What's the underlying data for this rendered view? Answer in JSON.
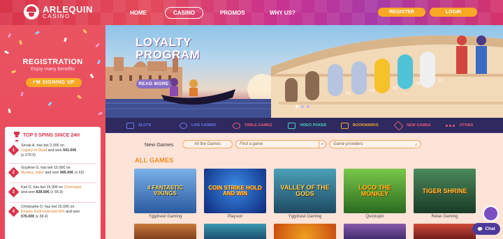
{
  "header": {
    "logo_line1": "ARLEQUIN",
    "logo_line2": "CASINO",
    "nav": [
      {
        "label": "HOME"
      },
      {
        "label": "CASINO"
      },
      {
        "label": "PROMOS"
      },
      {
        "label": "WHY US?"
      }
    ],
    "register_label": "REGISTER",
    "login_label": "LOGIN",
    "accent": "#f9a825"
  },
  "sidebar": {
    "reg_title": "REGISTRATION",
    "reg_sub": "Enjoy many benefits",
    "signup_label": "I'M SIGNING UP",
    "spins_title": "TOP 5 SPINS SINCE 24H",
    "spins": [
      {
        "num": "1",
        "who": "Sevak A. has bet 2.00€ on",
        "game": "Legacy of Dead",
        "rest": "and won",
        "win": "541.00€",
        "mult": "(x 270.5)"
      },
      {
        "num": "2",
        "who": "Guylene G. has bet 15.00€ on",
        "game": "Mystery Joker",
        "rest": "and won",
        "win": "945.00€",
        "mult": "(x 63)"
      },
      {
        "num": "3",
        "who": "Karl D. has bet 15.00€ on",
        "game": "Cherrypop",
        "rest": "and won",
        "win": "838.60€",
        "mult": "(x 55.9)"
      },
      {
        "num": "4",
        "who": "Christophe D. has bet 15.00€ on",
        "game": "Empire Gold Hold and Win",
        "rest": "and won",
        "win": "576.00€",
        "mult": "(x 38.4)"
      }
    ]
  },
  "hero": {
    "title_line1": "LOYALTY",
    "title_line2": "PROGRAM",
    "read_more": "READ MORE",
    "arch_numbers": [
      "03",
      "04",
      "05",
      "06",
      "07"
    ]
  },
  "categories": [
    {
      "label": "SLOTS",
      "color": "#6a7cf0"
    },
    {
      "label": "LIVE CASINO",
      "color": "#6a7cf0"
    },
    {
      "label": "TABLE GAMES",
      "color": "#e85a7a"
    },
    {
      "label": "VIDEO POKER",
      "color": "#4fd1c5"
    },
    {
      "label": "BOOKMARKS",
      "color": "#f0a830"
    },
    {
      "label": "NEW GAMES",
      "color": "#e85a7a"
    },
    {
      "label": "OTHER",
      "color": "#e85a7a"
    }
  ],
  "filters": {
    "label": "New Games",
    "all_games": "All the Games",
    "search_placeholder": "Find a game",
    "providers_placeholder": "Game providers"
  },
  "games_title": "ALL GAMES",
  "games": [
    {
      "title": "4 FANTASTIC VIKINGS",
      "provider": "Yggdrasil Gaming",
      "bg": "#3a6fc0",
      "fg": "#ffd84a"
    },
    {
      "title": "COIN STRIKE HOLD AND WIN",
      "provider": "Playson",
      "bg": "#1b3f9a",
      "fg": "#ffd43a"
    },
    {
      "title": "VALLEY OF THE GODS",
      "provider": "Yggdrasil Gaming",
      "bg": "#2e6a88",
      "fg": "#f5d36a"
    },
    {
      "title": "LOCO THE MONKEY",
      "provider": "Quickspin",
      "bg": "#3f8a2c",
      "fg": "#f5c21a"
    },
    {
      "title": "TIGER SHRINE",
      "provider": "Relax Gaming",
      "bg": "#2a5a3a",
      "fg": "#f4c53a"
    }
  ],
  "chat_label": "Chat"
}
